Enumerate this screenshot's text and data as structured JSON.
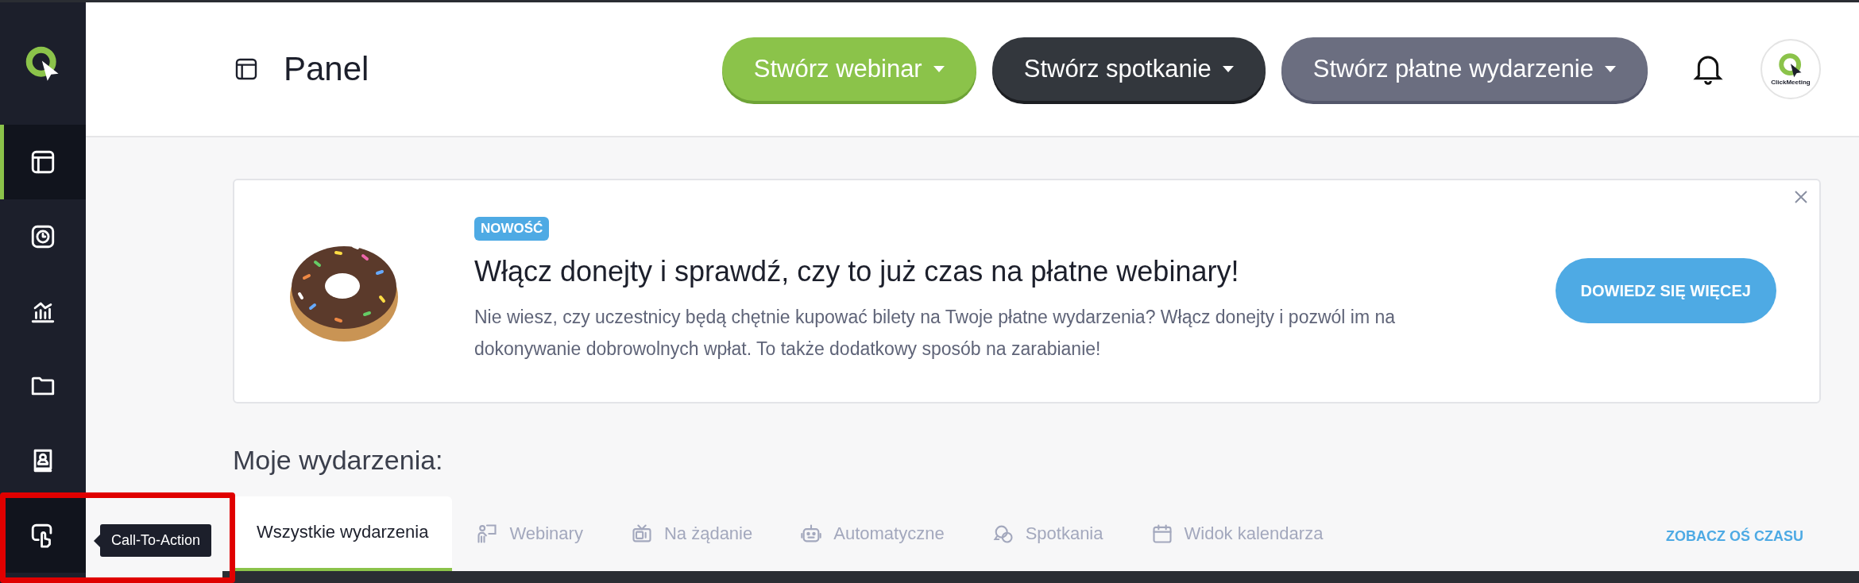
{
  "sidebar": {
    "items": [
      {
        "selected": true
      },
      {
        "selected": false
      },
      {
        "selected": false
      },
      {
        "selected": false
      },
      {
        "selected": false
      },
      {
        "selected": true,
        "tooltip": "Call-To-Action"
      }
    ]
  },
  "header": {
    "title": "Panel",
    "buttons": [
      {
        "label": "Stwórz webinar",
        "kind": "green"
      },
      {
        "label": "Stwórz spotkanie",
        "kind": "dark"
      },
      {
        "label": "Stwórz płatne wydarzenie",
        "kind": "gray"
      }
    ],
    "avatar_text": "ClickMeeting"
  },
  "banner": {
    "badge": "NOWOŚĆ",
    "title": "Włącz donejty i sprawdź, czy to już czas na płatne webinary!",
    "description": "Nie wiesz, czy uczestnicy będą chętnie kupować bilety na Twoje płatne wydarzenia? Włącz donejty i pozwól im na dokonywanie dobrowolnych wpłat. To także dodatkowy sposób na zarabianie!",
    "button": "DOWIEDZ SIĘ WIĘCEJ"
  },
  "events": {
    "heading": "Moje wydarzenia:",
    "tabs": [
      {
        "label": "Wszystkie wydarzenia",
        "selected": true
      },
      {
        "label": "Webinary",
        "selected": false
      },
      {
        "label": "Na żądanie",
        "selected": false
      },
      {
        "label": "Automatyczne",
        "selected": false
      },
      {
        "label": "Spotkania",
        "selected": false
      },
      {
        "label": "Widok kalendarza",
        "selected": false
      }
    ],
    "timeline_link": "ZOBACZ OŚ CZASU"
  }
}
